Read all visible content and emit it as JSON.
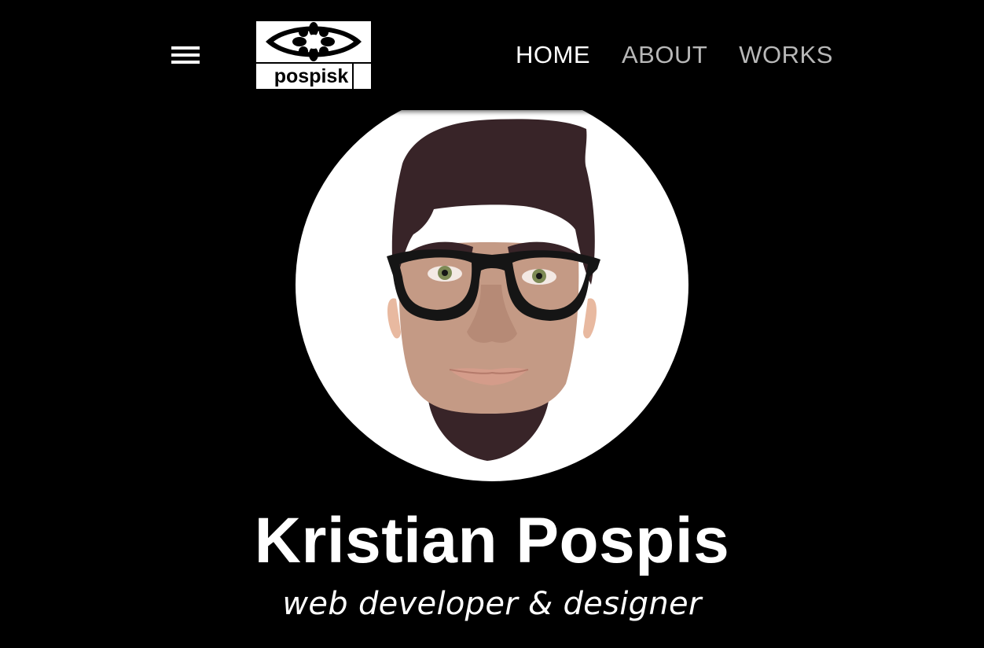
{
  "header": {
    "menu_icon": "hamburger-menu-icon",
    "logo": {
      "icon": "eye-flower-logo-icon",
      "text": "pospisk"
    },
    "nav": [
      {
        "label": "HOME",
        "state": "active"
      },
      {
        "label": "ABOUT",
        "state": "inactive"
      },
      {
        "label": "WORKS",
        "state": "inactive"
      }
    ]
  },
  "hero": {
    "avatar_icon": "illustrated-portrait-avatar",
    "name": "Kristian Pospis",
    "tagline": "web developer & designer"
  },
  "colors": {
    "background": "#000000",
    "text": "#ffffff",
    "nav_inactive": "#b8b8b8",
    "avatar_bg": "#ffffff",
    "hair": "#382428",
    "skin": "#c49a85",
    "glasses": "#151515",
    "eyes": "#7d8a55"
  }
}
